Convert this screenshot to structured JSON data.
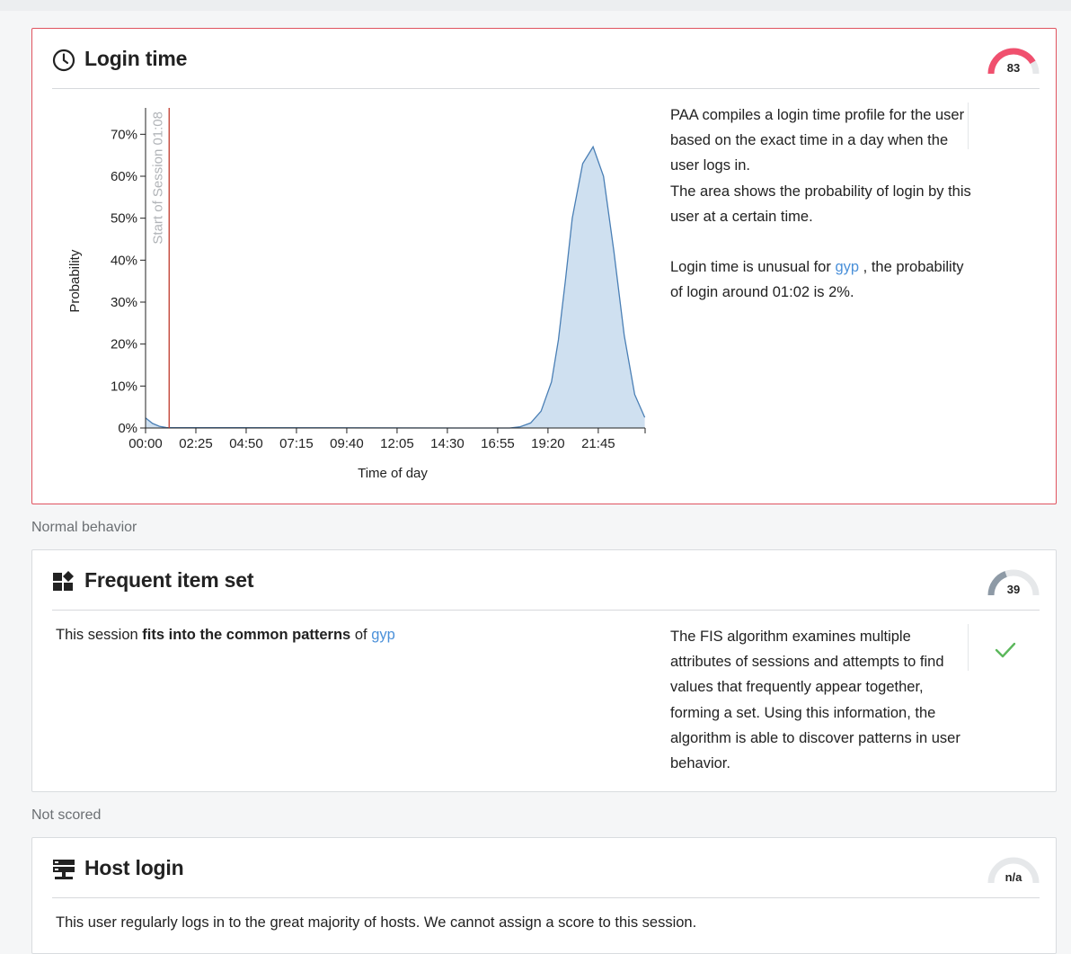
{
  "sections": {
    "normal": "Normal behavior",
    "not_scored": "Not scored"
  },
  "login_time": {
    "title": "Login time",
    "score": "83",
    "score_color": "#f0506e",
    "icon": "clock-icon",
    "desc": {
      "p1": "PAA compiles a login time profile for the user based on the exact time in a day when the user logs in.",
      "p2": "The area shows the probability of login by this user at a certain time.",
      "p3_prefix": "Login time is unusual for",
      "user": "gyp",
      "p3_suffix": ", the probability of login around 01:02 is 2%."
    },
    "chart_data": {
      "type": "area",
      "xlabel": "Time of day",
      "ylabel": "Probability",
      "x_ticks": [
        "00:00",
        "02:25",
        "04:50",
        "07:15",
        "09:40",
        "12:05",
        "14:30",
        "16:55",
        "19:20",
        "21:45"
      ],
      "y_ticks": [
        "0%",
        "10%",
        "20%",
        "30%",
        "40%",
        "50%",
        "60%",
        "70%"
      ],
      "ylim": [
        0,
        72
      ],
      "xlim_minutes": [
        0,
        1440
      ],
      "marker": {
        "label": "Start of Session 01:08",
        "minutes": 68,
        "color": "#c0392b"
      },
      "fill_color": "#cfe0f0",
      "line_color": "#4a7fb5",
      "series": [
        {
          "x_minutes": [
            0,
            20,
            40,
            60,
            900,
            1050,
            1080,
            1110,
            1140,
            1170,
            1190,
            1200,
            1210,
            1230,
            1260,
            1290,
            1320,
            1350,
            1380,
            1410,
            1439
          ],
          "values": [
            2.4,
            1.1,
            0.4,
            0.1,
            0,
            0,
            0.3,
            1.2,
            4,
            11,
            21,
            28,
            35,
            50,
            63,
            67,
            60,
            42,
            22,
            8,
            2.5
          ]
        }
      ]
    }
  },
  "fis": {
    "title": "Frequent item set",
    "score": "39",
    "score_color": "#8e9aa6",
    "icon": "item-set-icon",
    "body_prefix": "This session",
    "body_bold": "fits into the common patterns",
    "body_mid": "of",
    "user": "gyp",
    "desc": "The FIS algorithm examines multiple attributes of sessions and attempts to find values that frequently appear together, forming a set. Using this information, the algorithm is able to discover patterns in user behavior.",
    "status_icon": "check-icon",
    "status_color": "#5cb85c"
  },
  "host_login": {
    "title": "Host login",
    "score": "n/a",
    "icon": "server-icon",
    "body": "This user regularly logs in to the great majority of hosts. We cannot assign a score to this session."
  }
}
